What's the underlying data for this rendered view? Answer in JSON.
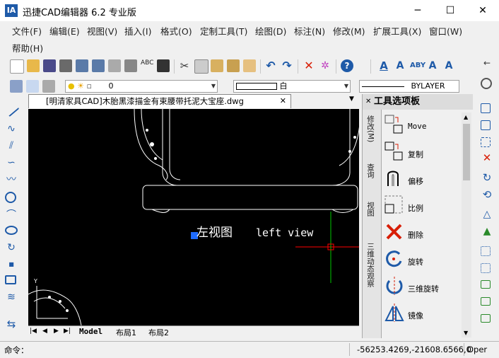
{
  "window": {
    "title": "迅捷CAD编辑器 6.2 专业版",
    "logo_text": "IA",
    "minimize": "─",
    "maximize": "☐",
    "close": "✕"
  },
  "menu": {
    "items": [
      "文件(F)",
      "编辑(E)",
      "视图(V)",
      "插入(I)",
      "格式(O)",
      "定制工具(T)",
      "绘图(D)",
      "标注(N)",
      "修改(M)",
      "扩展工具(X)",
      "窗口(W)"
    ],
    "help": "帮助(H)"
  },
  "layer_toolbar": {
    "layer_value": "0",
    "color_value": "白",
    "linetype_value": "BYLAYER"
  },
  "document": {
    "tab_label": "[明清家具CAD]木胎黑漆描金有束腰带托泥大宝座.dwg",
    "close_glyph": "✕",
    "canvas_text_cn": "左视图",
    "canvas_text_en": "left view",
    "axis_y": "Y"
  },
  "layout_tabs": [
    "Model",
    "布局1",
    "布局2"
  ],
  "palette": {
    "title": "工具选项板",
    "vertical_tabs": [
      "修改(M)",
      "查询",
      "视图",
      "三维动态观察"
    ],
    "tools": [
      {
        "label": "Move",
        "icon": "move-icon"
      },
      {
        "label": "复制",
        "icon": "copy-icon"
      },
      {
        "label": "偏移",
        "icon": "offset-icon"
      },
      {
        "label": "比例",
        "icon": "scale-icon"
      },
      {
        "label": "删除",
        "icon": "delete-icon"
      },
      {
        "label": "旋转",
        "icon": "rotate-icon"
      },
      {
        "label": "三维旋转",
        "icon": "rotate3d-icon"
      },
      {
        "label": "镜像",
        "icon": "mirror-icon"
      }
    ]
  },
  "status": {
    "command_label": "命令：",
    "coordinates": "-56253.4269,-21608.6566,0",
    "mode": "Oper"
  },
  "colors": {
    "canvas_bg": "#000000",
    "accent_blue": "#1e5aa8",
    "delete_red": "#d81e06",
    "crosshair_red": "#ff0000",
    "crosshair_green": "#00c800"
  }
}
